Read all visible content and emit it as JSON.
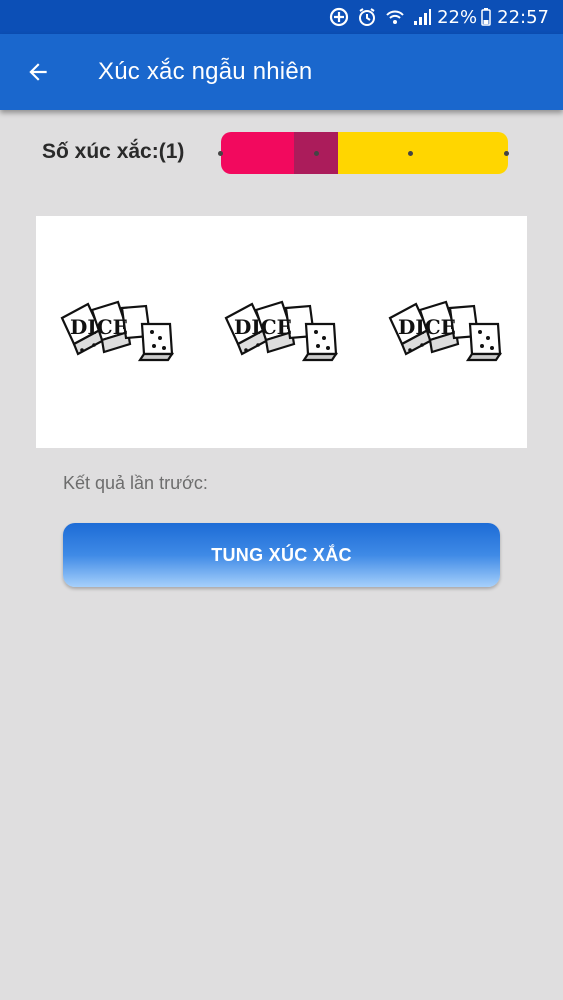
{
  "status_bar": {
    "battery_percent": "22%",
    "time": "22:57",
    "icons": [
      "data-saver-icon",
      "alarm-icon",
      "wifi-icon",
      "signal-icon",
      "battery-icon"
    ]
  },
  "app_bar": {
    "title": "Xúc xắc ngẫu nhiên",
    "back_icon": "arrow-left-icon"
  },
  "dice_count": {
    "label": "Số xúc xắc:(1)",
    "selected": 1,
    "steps": 3,
    "colors": {
      "left": "#f2095e",
      "thumb": "#ab1c5b",
      "right": "#ffd600"
    }
  },
  "dice_panel": {
    "images": [
      "dice-image",
      "dice-image",
      "dice-image"
    ],
    "dice_logo_text": "DICE"
  },
  "previous_result": {
    "label": "Kết quả lần trước:"
  },
  "roll_button": {
    "label": "TUNG XÚC XẮC"
  },
  "colors": {
    "status_bar": "#0c4fb6",
    "app_bar": "#1a67cd",
    "background": "#dfdedf"
  }
}
